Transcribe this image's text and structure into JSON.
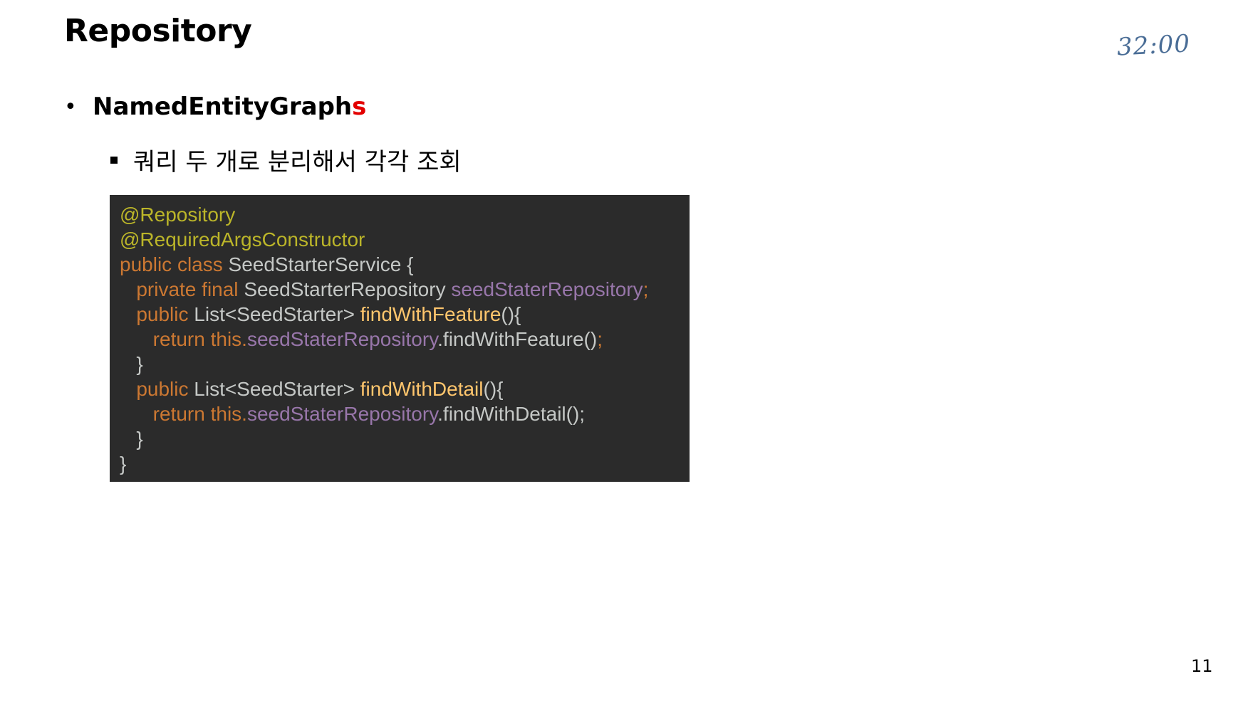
{
  "slide": {
    "title": "Repository",
    "timer_note": "32:00",
    "page_number": "11"
  },
  "bullet1": {
    "marker": "•",
    "text_main": "NamedEntityGraph",
    "text_accent": "s",
    "accent_color": "#e30000"
  },
  "bullet2": {
    "text": "쿼리 두 개로 분리해서 각각 조회"
  },
  "code": {
    "background": "#2b2b2b",
    "lines": [
      [
        {
          "t": "@Repository",
          "c": "ann"
        }
      ],
      [
        {
          "t": "@RequiredArgsConstructor",
          "c": "ann"
        }
      ],
      [
        {
          "t": "public class ",
          "c": "kw"
        },
        {
          "t": "SeedStarterService {",
          "c": "plain"
        }
      ],
      [
        {
          "t": "   private final ",
          "c": "kw"
        },
        {
          "t": "SeedStarterRepository ",
          "c": "plain"
        },
        {
          "t": "seedStaterRepository",
          "c": "fld"
        },
        {
          "t": ";",
          "c": "kw"
        }
      ],
      [
        {
          "t": "   public ",
          "c": "kw"
        },
        {
          "t": "List<SeedStarter> ",
          "c": "plain"
        },
        {
          "t": "findWithFeature",
          "c": "fn"
        },
        {
          "t": "(){",
          "c": "plain"
        }
      ],
      [
        {
          "t": "      return this.",
          "c": "kw"
        },
        {
          "t": "seedStaterRepository",
          "c": "fld"
        },
        {
          "t": ".findWithFeature()",
          "c": "plain"
        },
        {
          "t": ";",
          "c": "kw"
        }
      ],
      [
        {
          "t": "   }",
          "c": "plain"
        }
      ],
      [
        {
          "t": "   public ",
          "c": "kw"
        },
        {
          "t": "List<SeedStarter> ",
          "c": "plain"
        },
        {
          "t": "findWithDetail",
          "c": "fn"
        },
        {
          "t": "(){",
          "c": "plain"
        }
      ],
      [
        {
          "t": "      return this.",
          "c": "kw"
        },
        {
          "t": "seedStaterRepository",
          "c": "fld"
        },
        {
          "t": ".findWithDetail();",
          "c": "plain"
        }
      ],
      [
        {
          "t": "   }",
          "c": "plain"
        }
      ],
      [
        {
          "t": "}",
          "c": "plain"
        }
      ]
    ]
  }
}
